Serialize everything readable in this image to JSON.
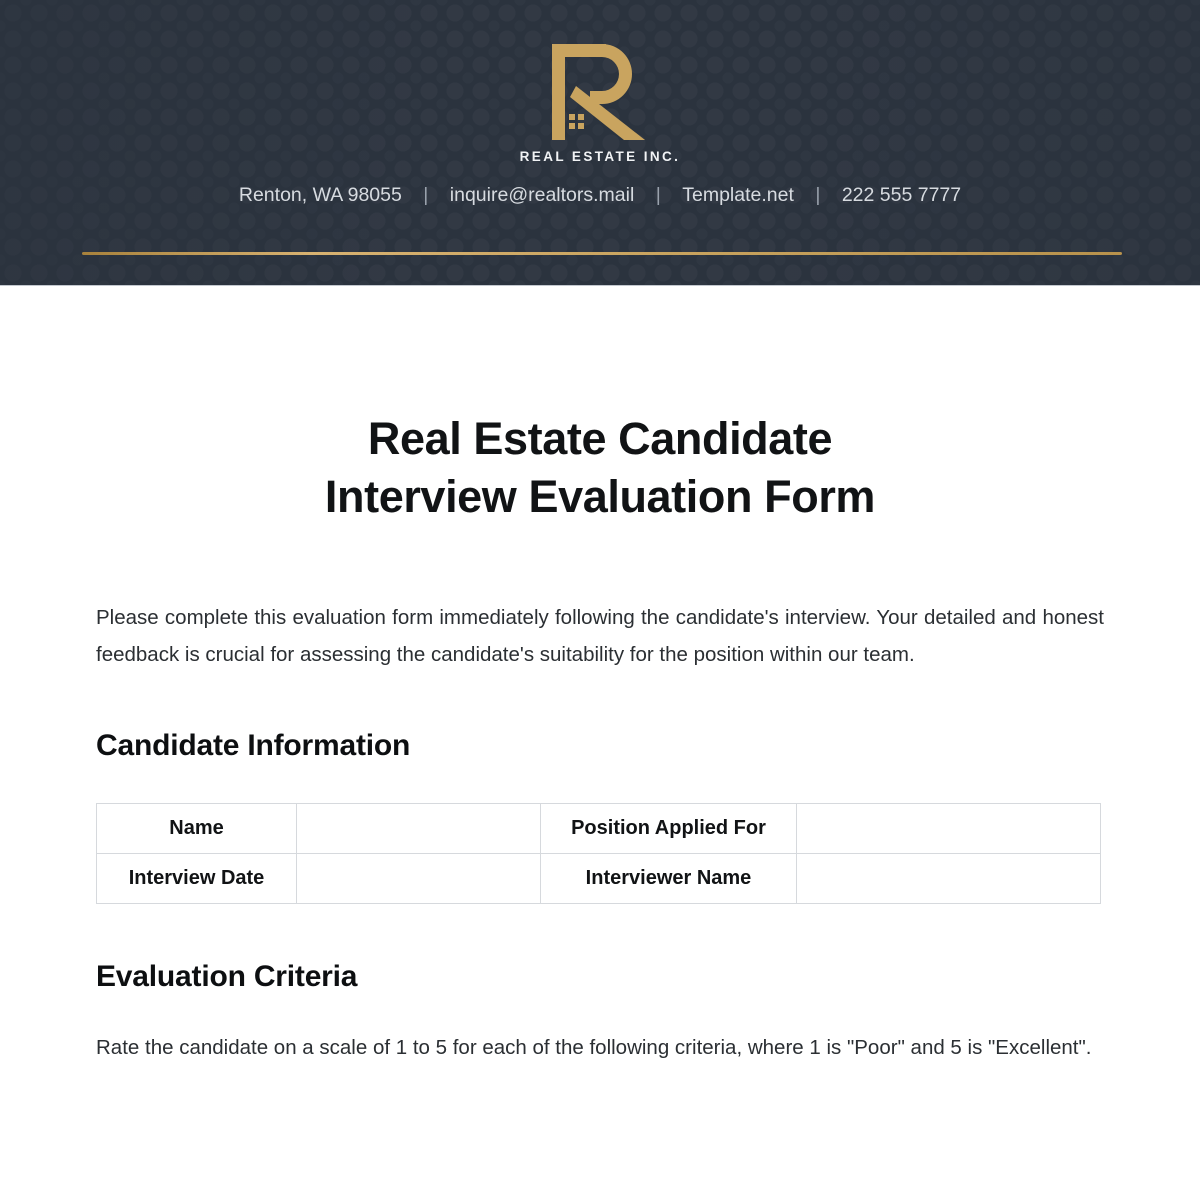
{
  "header": {
    "logo": {
      "icon_name": "real-estate-r-house-logo",
      "wordmark": "REAL ESTATE INC.",
      "gold": "#c9a45f",
      "background": "#2b333e"
    },
    "contact": {
      "address": "Renton, WA 98055",
      "email": "inquire@realtors.mail",
      "website": "Template.net",
      "phone": "222 555 7777",
      "separator": "|"
    },
    "rule_color": "#c9a45f"
  },
  "document": {
    "title_line_1": "Real Estate Candidate",
    "title_line_2": "Interview Evaluation Form",
    "intro": "Please complete this evaluation form immediately following the candidate's interview. Your detailed and honest feedback is crucial for assessing the candidate's suitability for the position within our team."
  },
  "candidate_information": {
    "heading": "Candidate Information",
    "rows": [
      {
        "label_left": "Name",
        "value_left": "",
        "label_right": "Position Applied For",
        "value_right": ""
      },
      {
        "label_left": "Interview Date",
        "value_left": "",
        "label_right": "Interviewer Name",
        "value_right": ""
      }
    ]
  },
  "evaluation_criteria": {
    "heading": "Evaluation Criteria",
    "instruction_line_1": "Rate the candidate on a scale of 1 to 5 for each of the following criteria, where 1 is",
    "instruction_line_2": "\"Poor\" and 5 is \"Excellent\"."
  }
}
